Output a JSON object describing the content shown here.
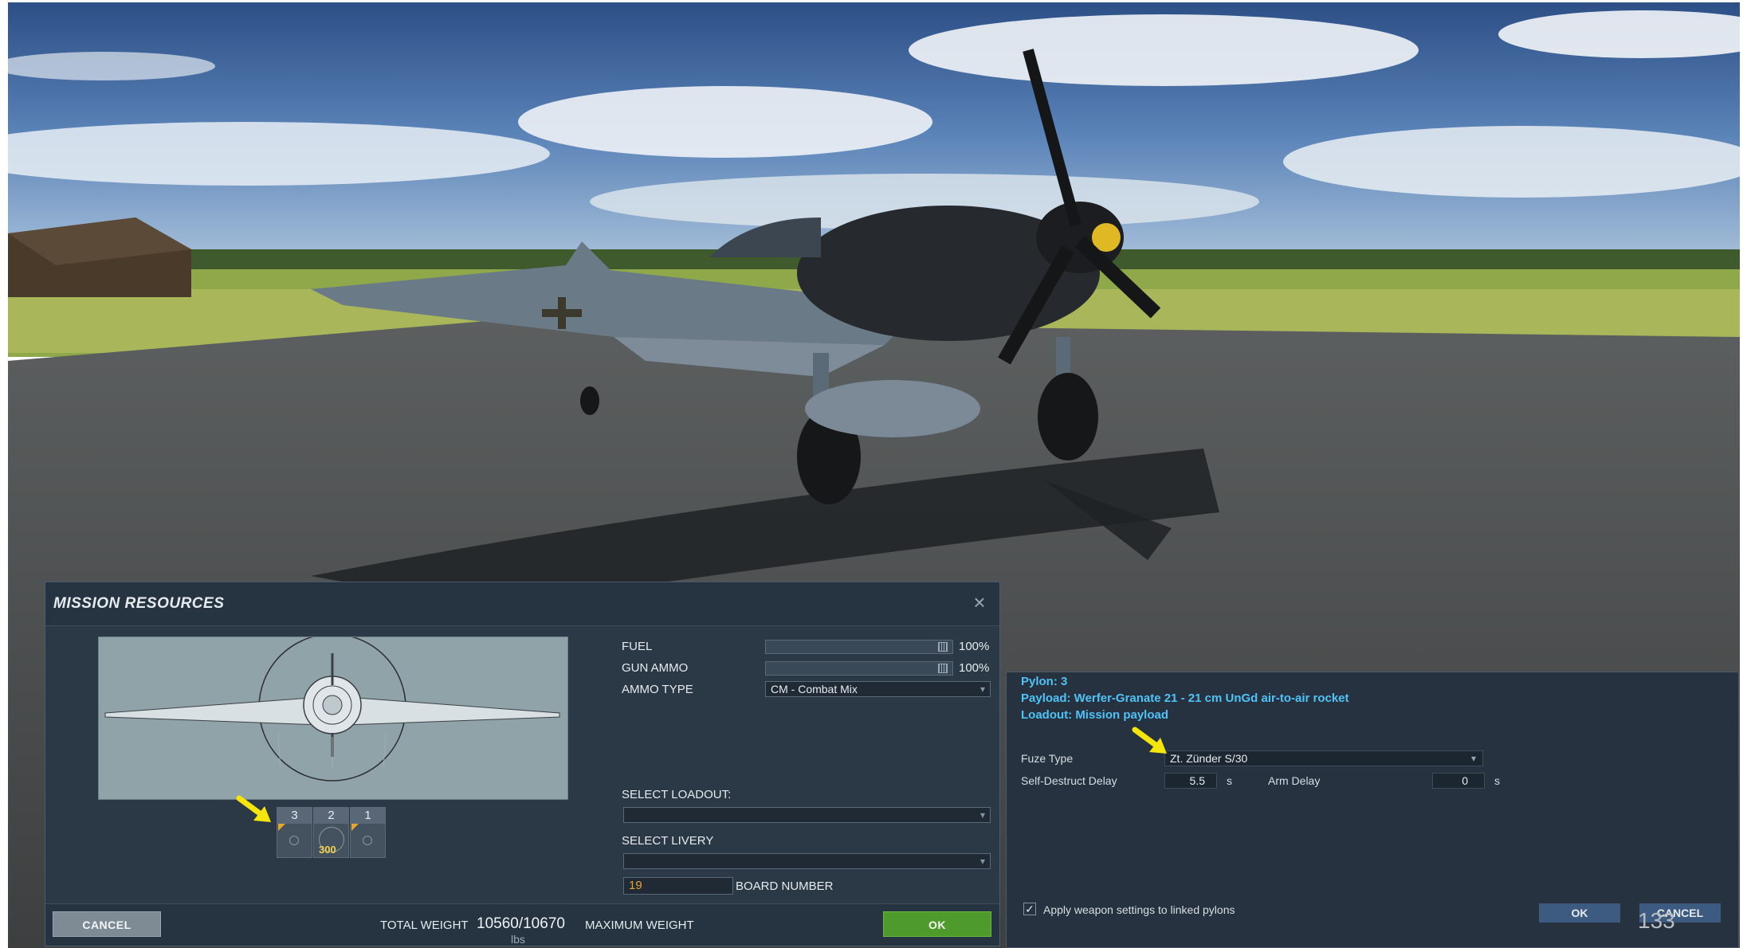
{
  "colors": {
    "panel_bg": "#2b3845",
    "ok_green": "#4f9a2c",
    "info_cyan": "#4fc3f7",
    "board_number_orange": "#e8a52b",
    "annotation_arrow": "#f5e50a"
  },
  "mission_resources": {
    "title": "MISSION RESOURCES",
    "close_icon": "close-icon",
    "pylons": [
      {
        "number": "3",
        "quantity": ""
      },
      {
        "number": "2",
        "quantity": "300"
      },
      {
        "number": "1",
        "quantity": ""
      }
    ],
    "fuel": {
      "label": "FUEL",
      "value": "100%",
      "fraction": 1.0
    },
    "gun_ammo": {
      "label": "GUN AMMO",
      "value": "100%",
      "fraction": 1.0
    },
    "ammo_type": {
      "label": "AMMO TYPE",
      "value": "CM - Combat Mix"
    },
    "select_loadout": {
      "label": "SELECT LOADOUT:",
      "value": ""
    },
    "select_livery": {
      "label": "SELECT LIVERY",
      "value": ""
    },
    "board_number": {
      "label": "BOARD NUMBER",
      "value": "19"
    },
    "footer": {
      "cancel": "CANCEL",
      "total_weight_label": "TOTAL WEIGHT",
      "total_weight_value": "10560/10670",
      "weight_unit": "lbs",
      "maximum_weight_label": "MAXIMUM WEIGHT",
      "ok": "OK"
    }
  },
  "weapon_settings": {
    "pylon": "Pylon: 3",
    "payload": "Payload: Werfer-Granate 21 - 21 cm UnGd air-to-air rocket",
    "loadout": "Loadout: Mission payload",
    "fuze_type": {
      "label": "Fuze Type",
      "value": "Zt. Zünder S/30"
    },
    "self_destruct_delay": {
      "label": "Self-Destruct Delay",
      "value": "5.5",
      "unit": "s"
    },
    "arm_delay": {
      "label": "Arm Delay",
      "value": "0",
      "unit": "s"
    },
    "apply_linked": {
      "label": "Apply weapon settings to linked pylons",
      "checked": true,
      "mark": "✓"
    },
    "ok": "OK",
    "cancel": "CANCEL"
  },
  "page_number": "133"
}
